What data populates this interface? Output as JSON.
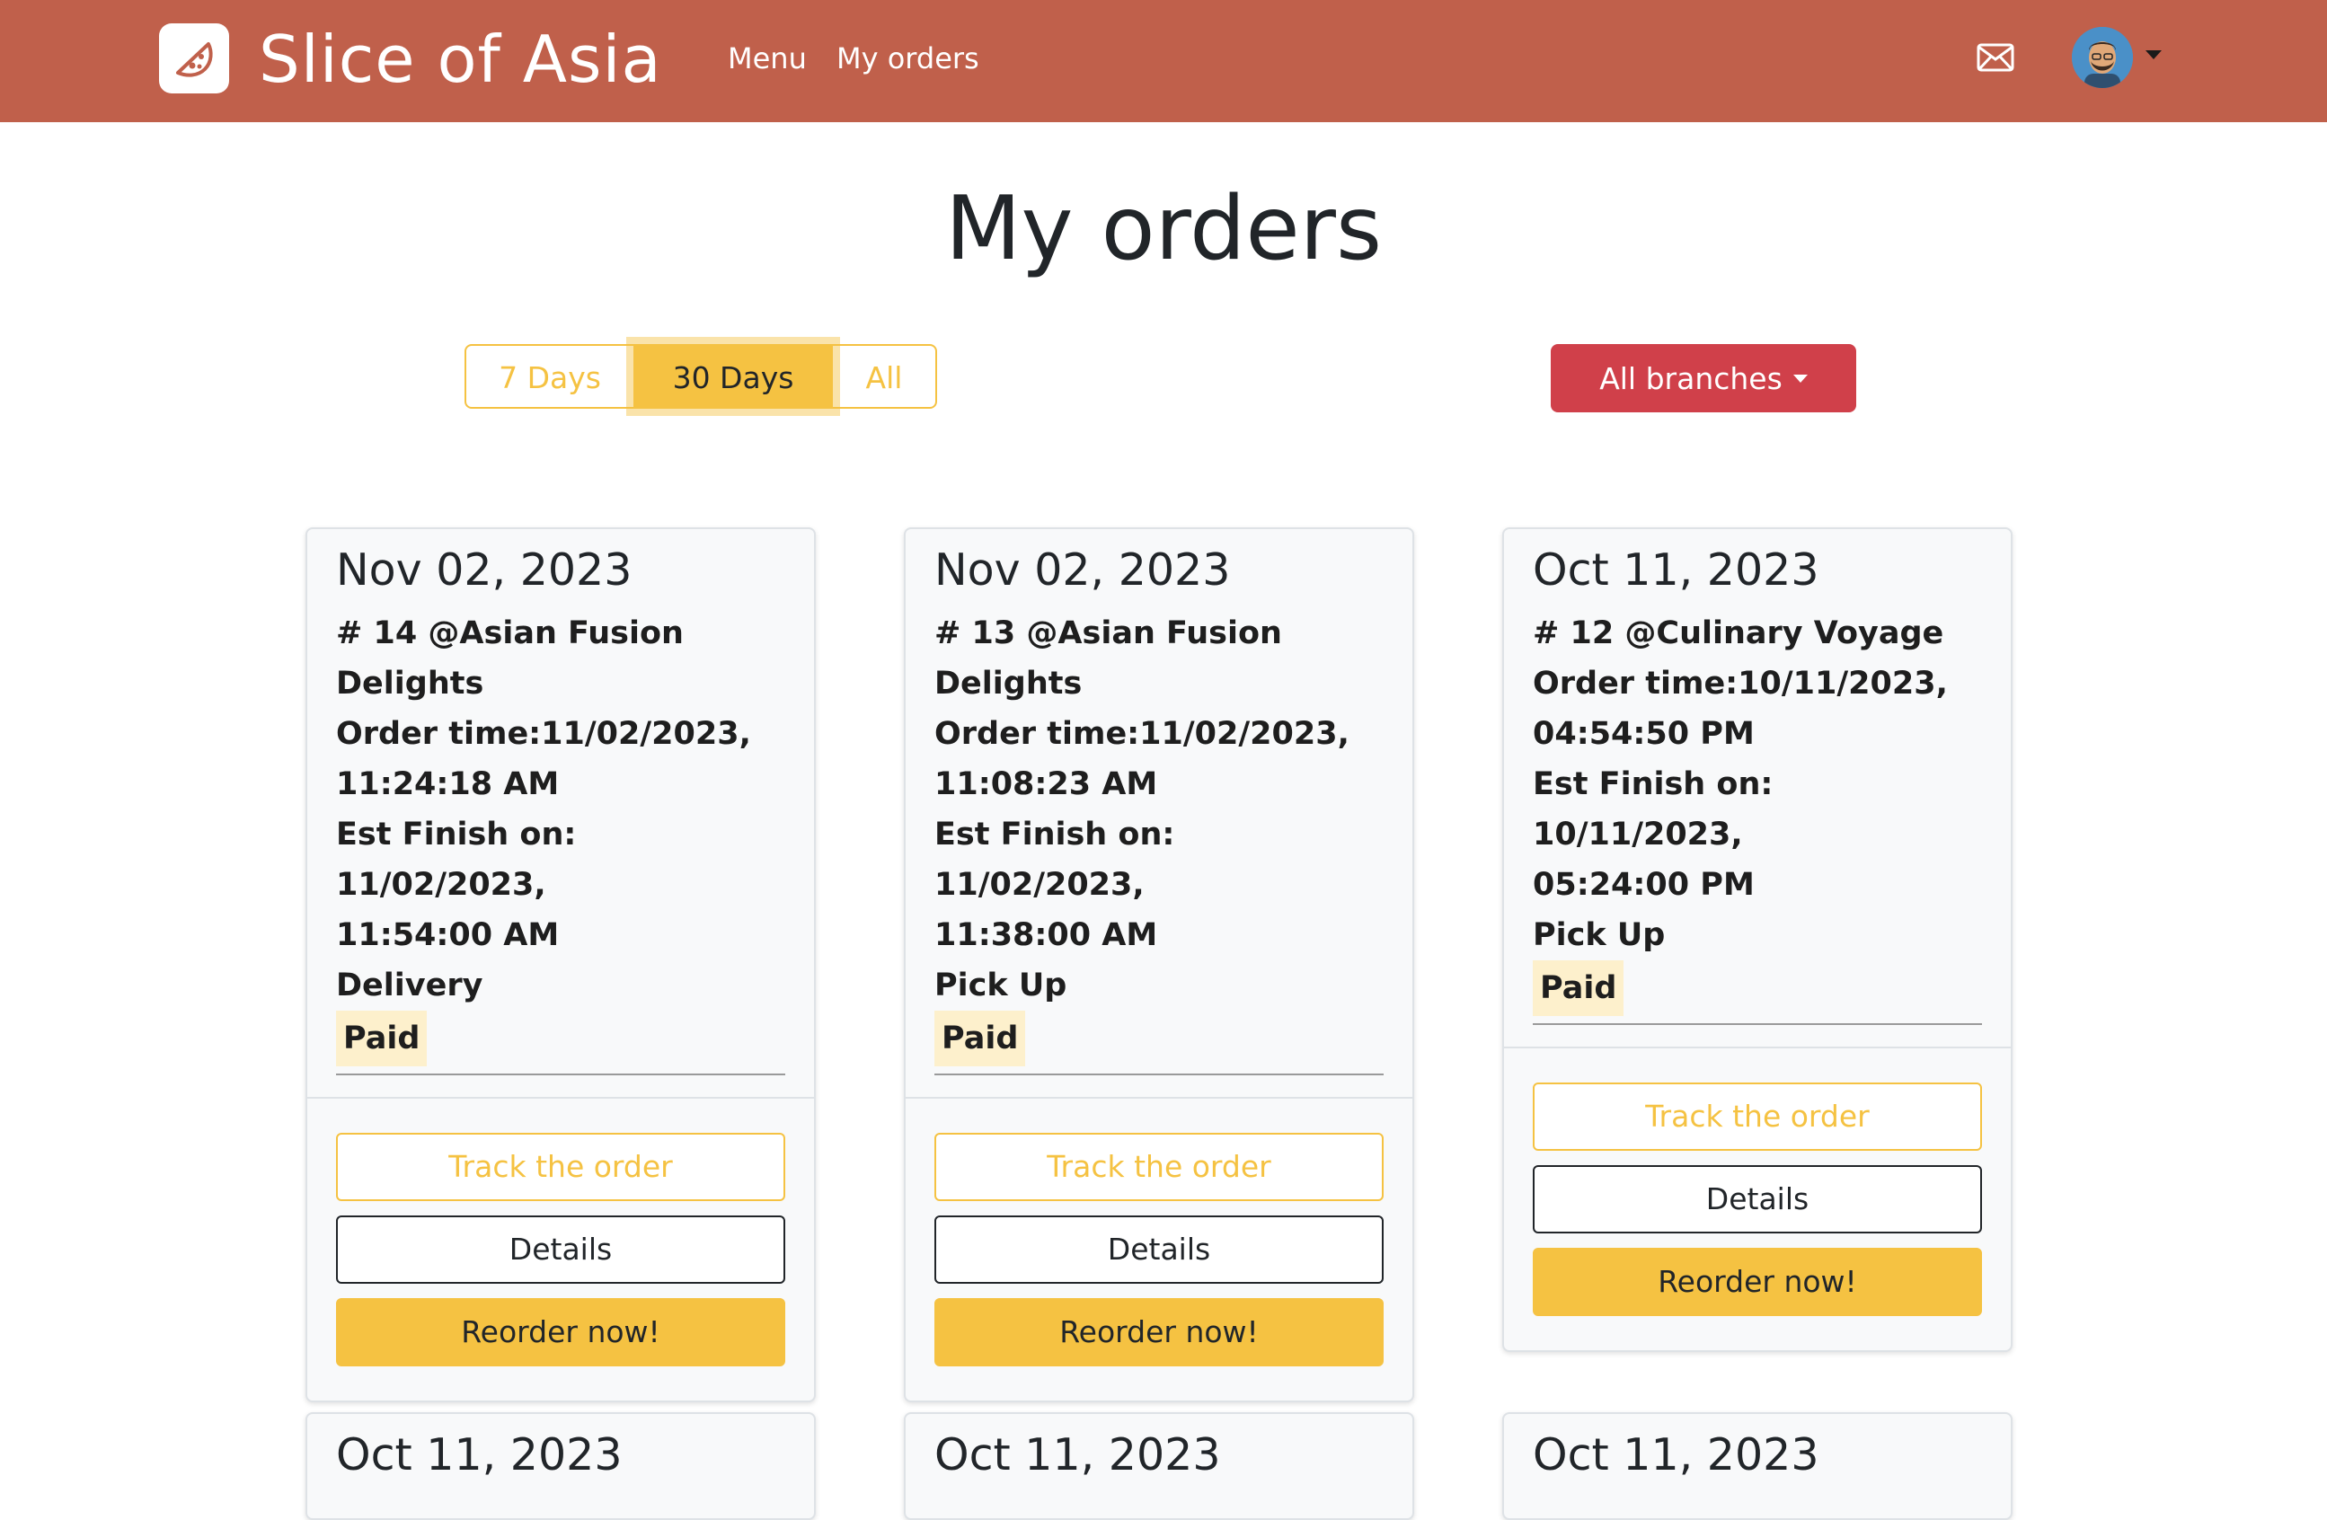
{
  "header": {
    "brand": "Slice of Asia",
    "nav": [
      {
        "label": "Menu"
      },
      {
        "label": "My orders"
      }
    ]
  },
  "page_title": "My orders",
  "filters": {
    "options": [
      "7 Days",
      "30 Days",
      "All"
    ],
    "active": "30 Days"
  },
  "branch_dropdown": {
    "label": "All branches"
  },
  "colors": {
    "navbar": "#c0604b",
    "accent": "#f5c242",
    "branch_button": "#d0404a",
    "paid_badge": "#fdf0cc"
  },
  "orders": [
    {
      "date": "Nov 02, 2023",
      "title_lines": [
        "# 14 @Asian Fusion",
        "Delights"
      ],
      "order_time_lines": [
        "Order time:11/02/2023,",
        "11:24:18 AM"
      ],
      "finish_lines": [
        "Est Finish on: 11/02/2023,",
        "11:54:00 AM"
      ],
      "method": "Delivery",
      "payment": "Paid",
      "buttons": {
        "track": "Track the order",
        "details": "Details",
        "reorder": "Reorder now!"
      }
    },
    {
      "date": "Nov 02, 2023",
      "title_lines": [
        "# 13 @Asian Fusion",
        "Delights"
      ],
      "order_time_lines": [
        "Order time:11/02/2023,",
        "11:08:23 AM"
      ],
      "finish_lines": [
        "Est Finish on: 11/02/2023,",
        "11:38:00 AM"
      ],
      "method": "Pick Up",
      "payment": "Paid",
      "buttons": {
        "track": "Track the order",
        "details": "Details",
        "reorder": "Reorder now!"
      }
    },
    {
      "date": "Oct 11, 2023",
      "title_lines": [
        "# 12 @Culinary Voyage"
      ],
      "order_time_lines": [
        "Order time:10/11/2023,",
        "04:54:50 PM"
      ],
      "finish_lines": [
        "Est Finish on: 10/11/2023,",
        "05:24:00 PM"
      ],
      "method": "Pick Up",
      "payment": "Paid",
      "buttons": {
        "track": "Track the order",
        "details": "Details",
        "reorder": "Reorder now!"
      }
    },
    {
      "date": "Oct 11, 2023"
    },
    {
      "date": "Oct 11, 2023"
    },
    {
      "date": "Oct 11, 2023"
    }
  ]
}
